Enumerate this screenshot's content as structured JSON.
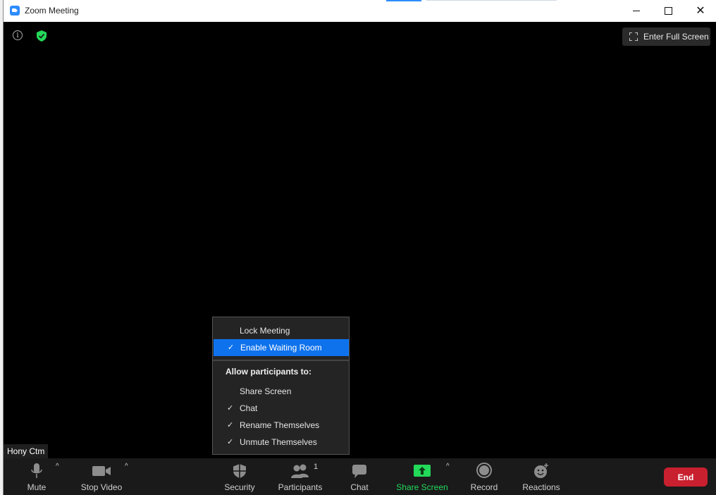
{
  "window": {
    "title": "Zoom Meeting"
  },
  "top": {
    "fullscreen_label": "Enter Full Screen"
  },
  "participant_name": "Hony Ctm",
  "toolbar": {
    "mute": "Mute",
    "stop_video": "Stop Video",
    "security": "Security",
    "participants": "Participants",
    "participants_count": "1",
    "chat": "Chat",
    "share_screen": "Share Screen",
    "record": "Record",
    "reactions": "Reactions",
    "end": "End"
  },
  "security_menu": {
    "lock_meeting": "Lock Meeting",
    "enable_waiting_room": "Enable Waiting Room",
    "allow_header": "Allow participants to:",
    "share_screen": "Share Screen",
    "chat": "Chat",
    "rename": "Rename Themselves",
    "unmute": "Unmute Themselves",
    "checkmark": "✓"
  },
  "colors": {
    "accent": "#0e72ed",
    "share_green": "#23d959",
    "end_red": "#c8202f",
    "shield_green": "#23d959"
  },
  "icons": [
    "info-icon",
    "shield-icon",
    "fullscreen-icon",
    "microphone-icon",
    "video-camera-icon",
    "security-shield-icon",
    "participants-icon",
    "chat-bubble-icon",
    "share-screen-icon",
    "record-icon",
    "reactions-icon"
  ]
}
